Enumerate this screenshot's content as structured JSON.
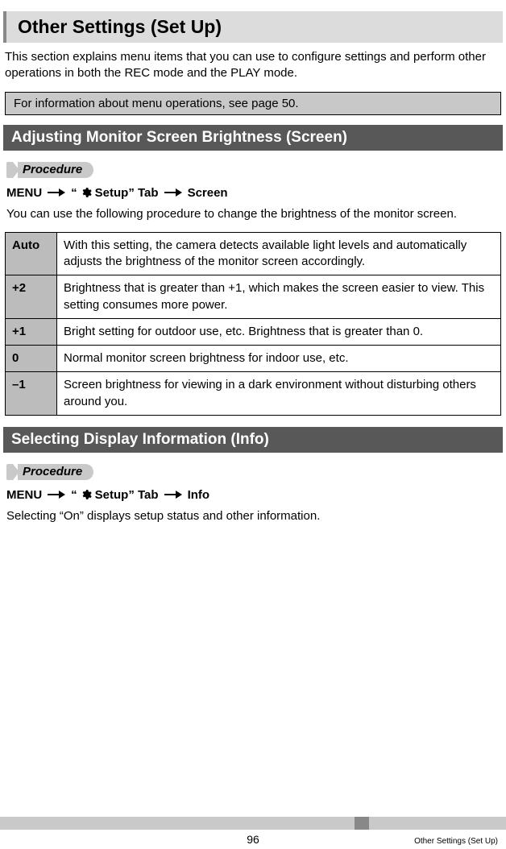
{
  "chapter_title": "Other Settings (Set Up)",
  "intro_text": "This section explains menu items that you can use to configure settings and perform other operations in both the REC mode and the PLAY mode.",
  "info_box": "For information about menu operations, see page 50.",
  "procedure_label": "Procedure",
  "sections": [
    {
      "title": "Adjusting Monitor Screen Brightness (Screen)",
      "path_pre": "MENU",
      "path_tab_pre": "“",
      "path_tab_post": " Setup” Tab",
      "path_target": "Screen",
      "body": "You can use the following procedure to change the brightness of the monitor screen.",
      "table": [
        {
          "label": "Auto",
          "desc": "With this setting, the camera detects available light levels and automatically adjusts the brightness of the monitor screen accordingly."
        },
        {
          "label": "+2",
          "desc": "Brightness that is greater than +1, which makes the screen easier to view. This setting consumes more power."
        },
        {
          "label": "+1",
          "desc": "Bright setting for outdoor use, etc. Brightness that is greater than 0."
        },
        {
          "label": "0",
          "desc": "Normal monitor screen brightness for indoor use, etc."
        },
        {
          "label": "–1",
          "desc": "Screen brightness for viewing in a dark environment without disturbing others around you."
        }
      ]
    },
    {
      "title": "Selecting Display Information (Info)",
      "path_pre": "MENU",
      "path_tab_pre": "“",
      "path_tab_post": " Setup” Tab",
      "path_target": "Info",
      "body": "Selecting “On” displays setup status and other information."
    }
  ],
  "footer": {
    "page_number": "96",
    "label": "Other Settings (Set Up)"
  }
}
